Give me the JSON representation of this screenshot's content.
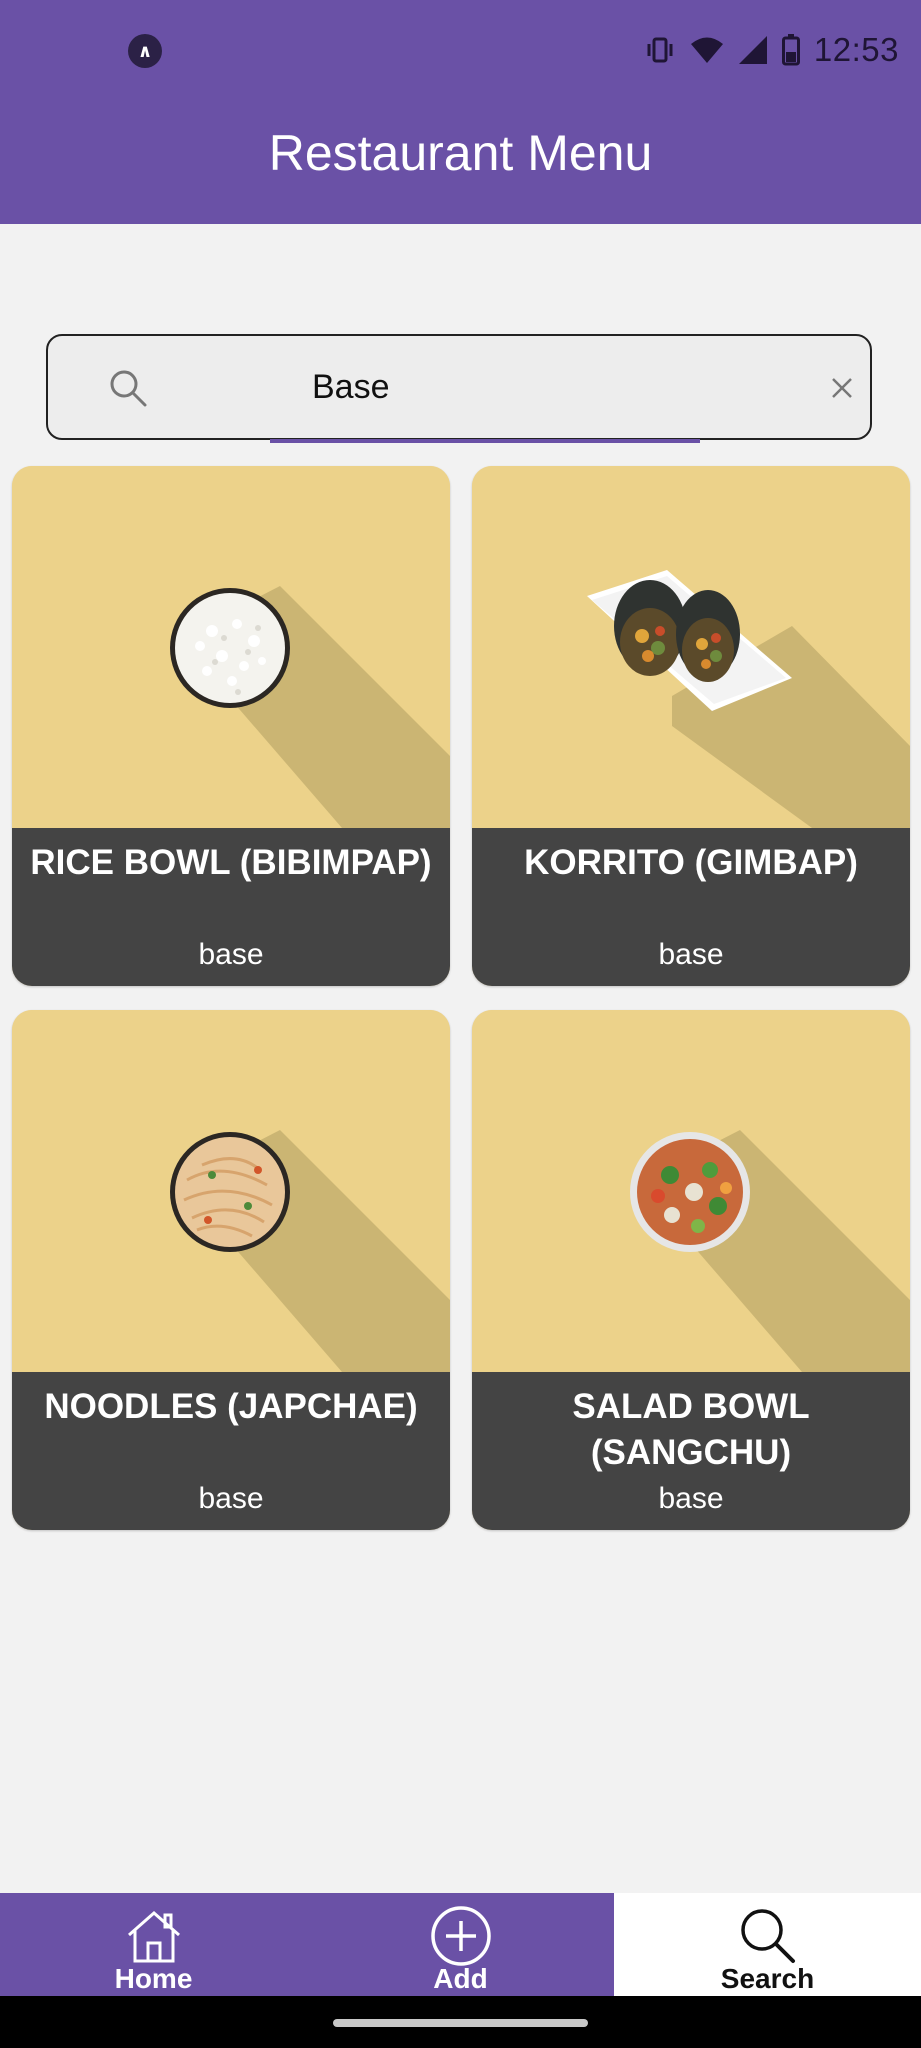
{
  "status_bar": {
    "time": "12:53",
    "app_icon": "expo-icon",
    "icons": [
      "vibrate-icon",
      "wifi-icon",
      "signal-icon",
      "battery-icon"
    ]
  },
  "header": {
    "title": "Restaurant Menu"
  },
  "search": {
    "value": "Base",
    "placeholder": "",
    "search_icon": "search-icon",
    "clear_icon": "close-icon"
  },
  "menu_items": [
    {
      "name": "RICE BOWL (BIBIMPAP)",
      "category": "base",
      "image": "rice-bowl"
    },
    {
      "name": "KORRITO (GIMBAP)",
      "category": "base",
      "image": "gimbap"
    },
    {
      "name": "NOODLES (JAPCHAE)",
      "category": "base",
      "image": "noodles"
    },
    {
      "name": "SALAD BOWL (SANGCHU)",
      "category": "base",
      "image": "salad-bowl"
    }
  ],
  "bottom_nav": {
    "items": [
      {
        "label": "Home",
        "icon": "home-icon",
        "active": false
      },
      {
        "label": "Add",
        "icon": "plus-circle-icon",
        "active": false
      },
      {
        "label": "Search",
        "icon": "search-icon",
        "active": true
      }
    ]
  },
  "colors": {
    "primary": "#6a51a6",
    "card_photo_bg": "#ecd28a",
    "card_label_bg": "#444444",
    "background": "#f2f2f2"
  }
}
